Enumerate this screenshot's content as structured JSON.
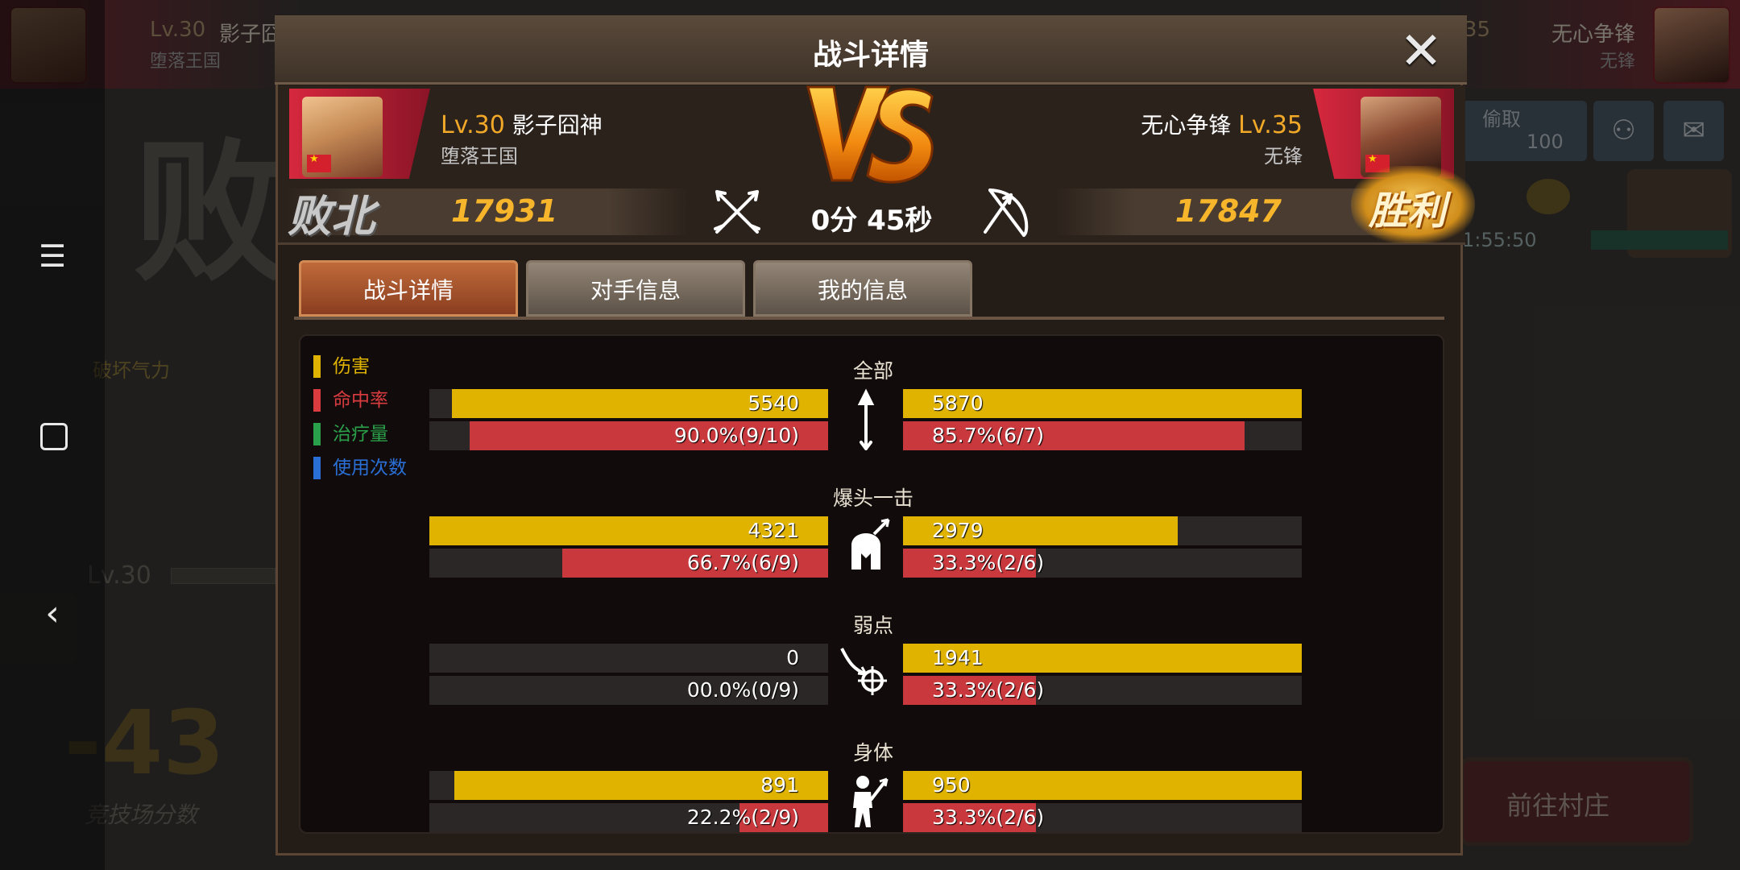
{
  "background": {
    "left_player": {
      "level": "Lv.30",
      "name": "影子囧",
      "guild": "堕落王国"
    },
    "right_player": {
      "level": "35",
      "name": "无心争锋",
      "guild": "无锋"
    },
    "defeat_char": "败",
    "break_label": "破坏气力",
    "level_label": "Lv.30",
    "arena_score": "-43",
    "arena_score_label": "竞技场分数",
    "steal_label": "偷取",
    "steal_value": "100",
    "timer": "1:55:50",
    "village_button": "前往村庄",
    "add_friend_icon": "add-friend-icon",
    "mail_icon": "mail-icon"
  },
  "system_nav": {
    "menu_icon": "☰",
    "back_icon": "‹"
  },
  "dialog": {
    "title": "战斗详情",
    "close_icon": "✕",
    "battle_time": "0分 45秒",
    "left_player": {
      "level": "Lv.30",
      "name": "影子囧神",
      "guild": "堕落王国",
      "score": "17931",
      "result": "败北"
    },
    "right_player": {
      "level": "Lv.35",
      "name": "无心争锋",
      "guild": "无锋",
      "score": "17847",
      "result": "胜利"
    }
  },
  "tabs": [
    {
      "label": "战斗详情",
      "active": true
    },
    {
      "label": "对手信息",
      "active": false
    },
    {
      "label": "我的信息",
      "active": false
    }
  ],
  "legend": [
    {
      "label": "伤害",
      "color": "#e0b300"
    },
    {
      "label": "命中率",
      "color": "#d93b3f"
    },
    {
      "label": "治疗量",
      "color": "#2aa04a"
    },
    {
      "label": "使用次数",
      "color": "#2a6fd6"
    }
  ],
  "stats": [
    {
      "category": "全部",
      "icon": "arrow-up-icon",
      "left": {
        "damage": 5540,
        "damage_label": "5540",
        "hit": 0.9,
        "hit_label": "90.0%(9/10)"
      },
      "right": {
        "damage": 5870,
        "damage_label": "5870",
        "hit": 0.857,
        "hit_label": "85.7%(6/7)"
      }
    },
    {
      "category": "爆头一击",
      "icon": "helmet-icon",
      "left": {
        "damage": 4321,
        "damage_label": "4321",
        "hit": 0.667,
        "hit_label": "66.7%(6/9)"
      },
      "right": {
        "damage": 2979,
        "damage_label": "2979",
        "hit": 0.333,
        "hit_label": "33.3%(2/6)"
      }
    },
    {
      "category": "弱点",
      "icon": "weak-point-icon",
      "left": {
        "damage": 0,
        "damage_label": "0",
        "hit": 0,
        "hit_label": "00.0%(0/9)"
      },
      "right": {
        "damage": 1941,
        "damage_label": "1941",
        "hit": 0.333,
        "hit_label": "33.3%(2/6)"
      }
    },
    {
      "category": "身体",
      "icon": "body-icon",
      "left": {
        "damage": 891,
        "damage_label": "891",
        "hit": 0.222,
        "hit_label": "22.2%(2/9)"
      },
      "right": {
        "damage": 950,
        "damage_label": "950",
        "hit": 0.333,
        "hit_label": "33.3%(2/6)"
      }
    }
  ]
}
